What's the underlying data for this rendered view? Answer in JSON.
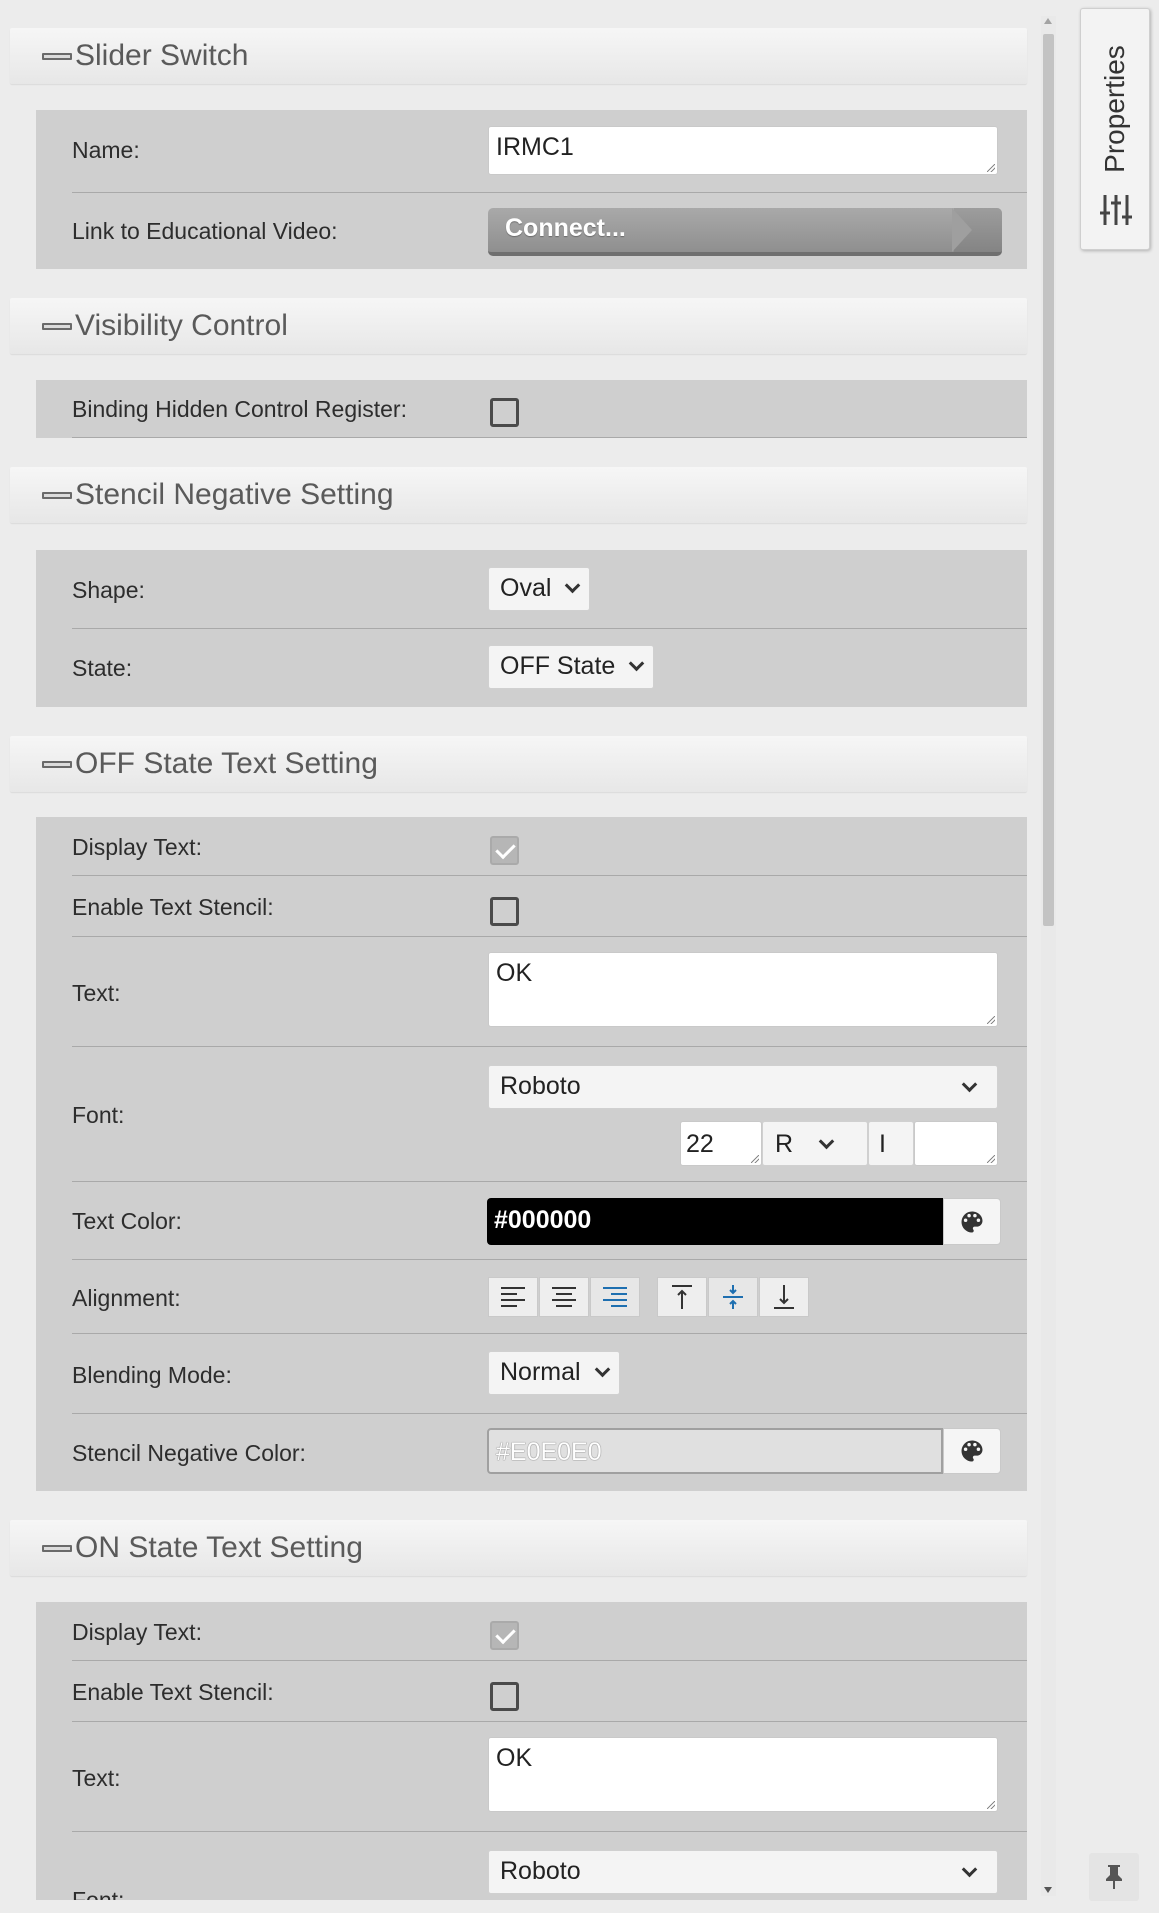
{
  "sidebar_tab": {
    "label": "Properties",
    "icon": "sliders-icon"
  },
  "sections": {
    "slider_switch": {
      "title": "Slider Switch",
      "name_label": "Name:",
      "name_value": "IRMC1",
      "video_label": "Link to Educational Video:",
      "video_button": "Connect..."
    },
    "visibility": {
      "title": "Visibility Control",
      "binding_label": "Binding Hidden Control Register:",
      "binding_checked": false
    },
    "stencil": {
      "title": "Stencil Negative Setting",
      "shape_label": "Shape:",
      "shape_value": "Oval",
      "state_label": "State:",
      "state_value": "OFF State"
    },
    "off_state": {
      "title": "OFF State Text Setting",
      "display_text_label": "Display Text:",
      "display_text_checked": true,
      "enable_stencil_label": "Enable Text Stencil:",
      "enable_stencil_checked": false,
      "text_label": "Text:",
      "text_value": "OK",
      "font_label": "Font:",
      "font_value": "Roboto",
      "font_size": "22",
      "font_weight": "R",
      "font_italic": "I",
      "text_color_label": "Text Color:",
      "text_color_value": "#000000",
      "alignment_label": "Alignment:",
      "blending_label": "Blending Mode:",
      "blending_value": "Normal",
      "stencil_color_label": "Stencil Negative Color:",
      "stencil_color_value": "#E0E0E0"
    },
    "on_state": {
      "title": "ON State Text Setting",
      "display_text_label": "Display Text:",
      "display_text_checked": true,
      "enable_stencil_label": "Enable Text Stencil:",
      "enable_stencil_checked": false,
      "text_label": "Text:",
      "text_value": "OK",
      "font_label": "Font:",
      "font_value": "Roboto"
    }
  },
  "colors": {
    "active_align": "#1e6fb0",
    "section_body": "#cfcfcf"
  }
}
